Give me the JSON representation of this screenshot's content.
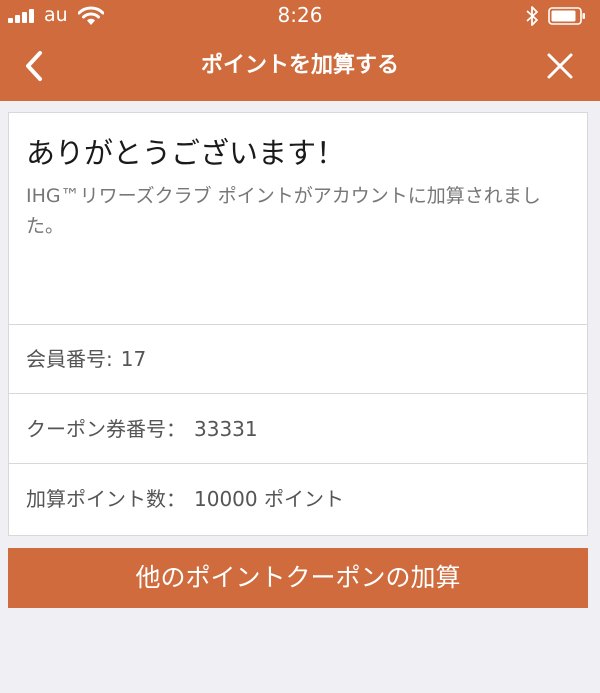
{
  "status_bar": {
    "carrier": "au",
    "time": "8:26"
  },
  "header": {
    "title": "ポイントを加算する",
    "back_icon": "chevron-left-icon",
    "close_icon": "close-icon"
  },
  "confirmation": {
    "title": "ありがとうございます！",
    "message": "IHG™リワーズクラブ ポイントがアカウントに加算されました。"
  },
  "details": [
    {
      "label": "会員番号:",
      "value": "17"
    },
    {
      "label": "クーポン券番号：",
      "value": "33331"
    },
    {
      "label": "加算ポイント数：",
      "value": "10000 ポイント"
    }
  ],
  "actions": {
    "add_another_label": "他のポイントクーポンの加算"
  },
  "colors": {
    "accent": "#cf6b3d",
    "background": "#efeff4",
    "card": "#ffffff"
  }
}
